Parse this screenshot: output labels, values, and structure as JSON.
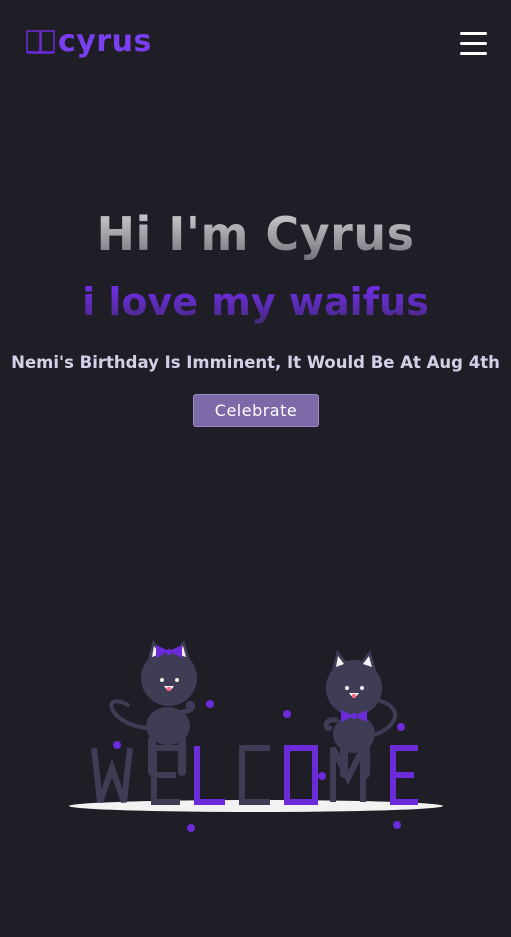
{
  "navbar": {
    "logo_text": "cyrus",
    "logo_icon": "open-book-icon",
    "menu_icon": "hamburger-menu-icon"
  },
  "hero": {
    "greeting": "Hi I'm Cyrus",
    "subtitle": "i love my waifus",
    "announcement": "Nemi's Birthday Is Imminent, It Would Be At Aug 4th",
    "button_label": "Celebrate"
  },
  "illustration": {
    "welcome_letters": [
      "W",
      "E",
      "L",
      "C",
      "O",
      "M",
      "E"
    ]
  },
  "colors": {
    "background": "#1f1e27",
    "accent": "#6c2bd9",
    "button": "#7d68a8",
    "text": "#d5d0e8",
    "muted": "#3f3d56"
  }
}
